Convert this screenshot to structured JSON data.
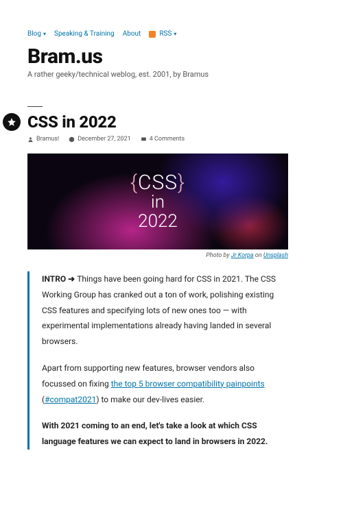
{
  "nav": {
    "blog": "Blog",
    "speaking": "Speaking & Training",
    "about": "About",
    "rss": "RSS"
  },
  "site": {
    "title": "Bram.us",
    "tagline": "A rather geeky/technical weblog, est. 2001, by Bramus"
  },
  "post": {
    "title": "CSS in 2022",
    "author": "Bramus!",
    "date": "December 27, 2021",
    "comments": "4 Comments"
  },
  "hero": {
    "line1a": "{",
    "line1b": "CSS",
    "line1c": "}",
    "line2": "in",
    "line3": "2022"
  },
  "caption": {
    "prefix": "Photo by ",
    "author": "Jr Korpa",
    "mid": " on ",
    "site": "Unsplash"
  },
  "body": {
    "intro_label": "INTRO ➜ ",
    "intro_text": "Things have been going hard for CSS in 2021. The CSS Working Group has cranked out a ton of work, polishing existing CSS features and specifying lots of new ones too — with experimental implementations already having landed in several browsers.",
    "p2_a": "Apart from supporting new features, browser vendors also focussed on fixing ",
    "p2_link1": "the top 5 browser compatibility painpoints",
    "p2_b": " (",
    "p2_link2": "#compat2021",
    "p2_c": ") to make our dev-lives easier.",
    "p3": "With 2021 coming to an end, let's take a look at which CSS language features we can expect to land in browsers in 2022."
  }
}
